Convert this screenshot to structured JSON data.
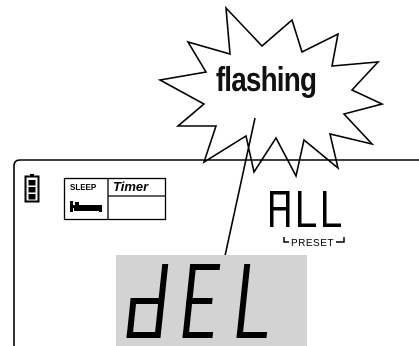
{
  "callout": {
    "text": "flashing"
  },
  "display": {
    "sleep_label": "SLEEP",
    "timer_label": "Timer",
    "top_right_readout": "ALL",
    "preset_label": "PRESET",
    "main_readout": "dEL"
  },
  "colors": {
    "highlight": "#d3d3d3",
    "segment": "#000000",
    "panel_border": "#000000"
  },
  "icons": [
    "battery-icon",
    "bed-icon"
  ]
}
